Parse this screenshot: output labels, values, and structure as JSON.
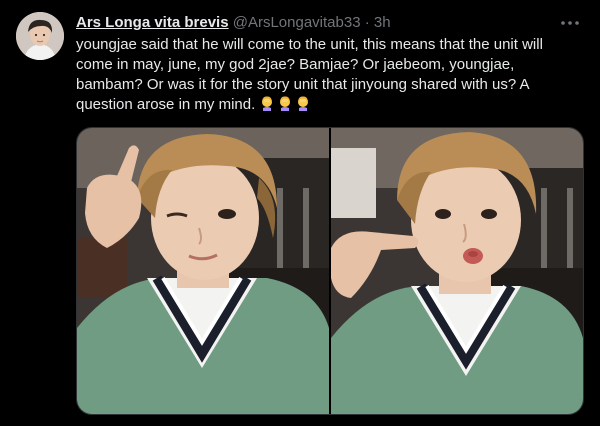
{
  "tweet": {
    "display_name": "Ars Longa vita brevis",
    "handle": "@ArsLongavitab33",
    "separator": "·",
    "time": "3h",
    "more_icon": "more-dots-icon",
    "text": "youngjae said that he will come to the unit, this means that the unit will come in may, june, my god 2jae?  Bamjae?  Or jaebeom, youngjae, bambam?  Or was it for the story unit that jinyoung shared with us?  A question arose in my mind.",
    "emoji": [
      "woman-facepalming",
      "woman-facepalming",
      "woman-facepalming"
    ],
    "colors": {
      "background": "#000000",
      "text": "#e7e9ea",
      "secondary": "#71767b",
      "border": "#2f3336"
    },
    "photos": [
      {
        "name": "photo-wink",
        "description_icon": "selfie-photo-icon"
      },
      {
        "name": "photo-kiss",
        "description_icon": "selfie-photo-icon"
      }
    ]
  }
}
